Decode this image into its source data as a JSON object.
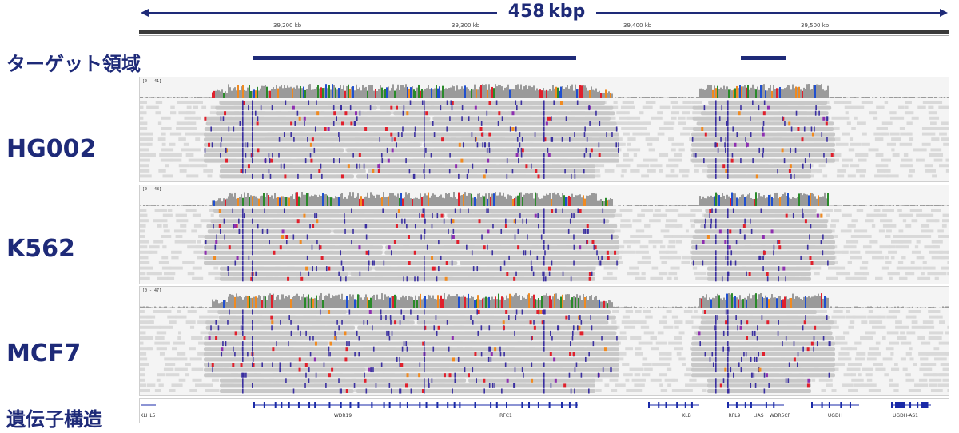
{
  "header": {
    "span_label": "458 kbp",
    "ruler_ticks": [
      "39,200 kb",
      "39,300 kb",
      "39,400 kb",
      "39,500 kb"
    ]
  },
  "target": {
    "label": "ターゲット領域"
  },
  "samples": [
    {
      "id": "hg002",
      "label": "HG002",
      "range": "[0 - 41]"
    },
    {
      "id": "k562",
      "label": "K562",
      "range": "[0 - 48]"
    },
    {
      "id": "mcf7",
      "label": "MCF7",
      "range": "[0 - 47]"
    }
  ],
  "genes": {
    "label": "遺伝子構造",
    "names": [
      "KLHL5",
      "WDR19",
      "RFC1",
      "KLB",
      "RPL9",
      "LIAS",
      "WDR5CP",
      "UGDH",
      "UGDH-AS1"
    ]
  },
  "colors": {
    "accent": "#1e2a78",
    "read": "#c8c8c8",
    "insertion": "#3a2fa0",
    "mismatch_red": "#e0202c",
    "mismatch_orange": "#f08a20",
    "coverage": "#9a9a9a"
  }
}
